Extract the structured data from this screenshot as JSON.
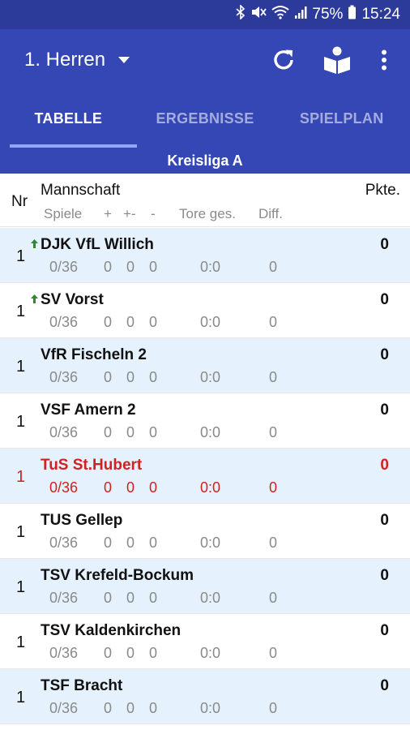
{
  "status_bar": {
    "battery": "75%",
    "time": "15:24"
  },
  "app_bar": {
    "team": "1. Herren"
  },
  "tabs": [
    {
      "label": "TABELLE",
      "active": true
    },
    {
      "label": "ERGEBNISSE",
      "active": false
    },
    {
      "label": "SPIELPLAN",
      "active": false
    }
  ],
  "league": "Kreisliga A",
  "header": {
    "nr": "Nr",
    "team": "Mannschaft",
    "points": "Pkte.",
    "games": "Spiele",
    "wins": "+",
    "draws": "+-",
    "losses": "-",
    "goals": "Tore ges.",
    "diff": "Diff."
  },
  "rows": [
    {
      "nr": "1",
      "team": "DJK VfL Willich",
      "games": "0/36",
      "wins": "0",
      "draws": "0",
      "losses": "0",
      "goals": "0:0",
      "diff": "0",
      "points": "0",
      "promoted": true,
      "highlight": false
    },
    {
      "nr": "1",
      "team": "SV Vorst",
      "games": "0/36",
      "wins": "0",
      "draws": "0",
      "losses": "0",
      "goals": "0:0",
      "diff": "0",
      "points": "0",
      "promoted": true,
      "highlight": false
    },
    {
      "nr": "1",
      "team": "VfR Fischeln 2",
      "games": "0/36",
      "wins": "0",
      "draws": "0",
      "losses": "0",
      "goals": "0:0",
      "diff": "0",
      "points": "0",
      "promoted": false,
      "highlight": false
    },
    {
      "nr": "1",
      "team": "VSF Amern 2",
      "games": "0/36",
      "wins": "0",
      "draws": "0",
      "losses": "0",
      "goals": "0:0",
      "diff": "0",
      "points": "0",
      "promoted": false,
      "highlight": false
    },
    {
      "nr": "1",
      "team": "TuS St.Hubert",
      "games": "0/36",
      "wins": "0",
      "draws": "0",
      "losses": "0",
      "goals": "0:0",
      "diff": "0",
      "points": "0",
      "promoted": false,
      "highlight": true
    },
    {
      "nr": "1",
      "team": "TUS Gellep",
      "games": "0/36",
      "wins": "0",
      "draws": "0",
      "losses": "0",
      "goals": "0:0",
      "diff": "0",
      "points": "0",
      "promoted": false,
      "highlight": false
    },
    {
      "nr": "1",
      "team": "TSV Krefeld-Bockum",
      "games": "0/36",
      "wins": "0",
      "draws": "0",
      "losses": "0",
      "goals": "0:0",
      "diff": "0",
      "points": "0",
      "promoted": false,
      "highlight": false
    },
    {
      "nr": "1",
      "team": "TSV Kaldenkirchen",
      "games": "0/36",
      "wins": "0",
      "draws": "0",
      "losses": "0",
      "goals": "0:0",
      "diff": "0",
      "points": "0",
      "promoted": false,
      "highlight": false
    },
    {
      "nr": "1",
      "team": "TSF Bracht",
      "games": "0/36",
      "wins": "0",
      "draws": "0",
      "losses": "0",
      "goals": "0:0",
      "diff": "0",
      "points": "0",
      "promoted": false,
      "highlight": false
    }
  ],
  "colors": {
    "primary": "#3547b4",
    "status_bar": "#2c3a9a",
    "row_alt": "#e5f1fd",
    "highlight": "#d32020",
    "promotion_arrow": "#2c8a2c"
  },
  "icons": [
    "bluetooth-icon",
    "mute-icon",
    "wifi-icon",
    "signal-icon",
    "battery-icon",
    "dropdown-caret-icon",
    "refresh-icon",
    "book-reader-icon",
    "more-vert-icon",
    "promotion-arrow-icon"
  ]
}
